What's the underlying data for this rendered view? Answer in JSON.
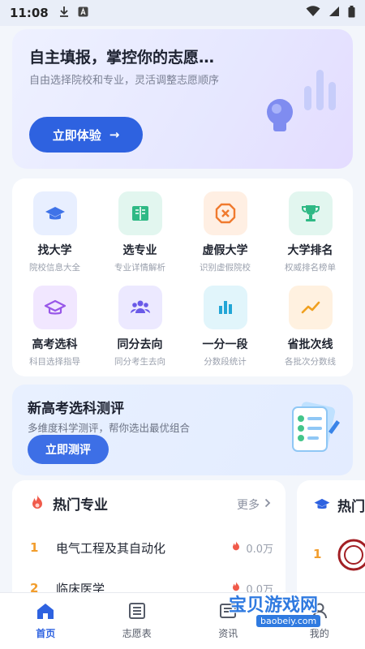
{
  "status_bar": {
    "time": "11:08",
    "download_icon": "download-icon",
    "a_icon": "a-badge-icon"
  },
  "hero": {
    "title": "自主填报，掌控你的志愿…",
    "subtitle": "自由选择院校和专业，灵活调整志愿顺序",
    "button_label": "立即体验",
    "button_arrow": "→"
  },
  "grid": [
    {
      "title": "找大学",
      "sub": "院校信息大全",
      "icon": "graduation-cap-icon",
      "bg": "#e8efff",
      "fg": "#3f73e8"
    },
    {
      "title": "选专业",
      "sub": "专业详情解析",
      "icon": "open-book-icon",
      "bg": "#e2f6ef",
      "fg": "#2fb985"
    },
    {
      "title": "虚假大学",
      "sub": "识别虚假院校",
      "icon": "warning-octagon-icon",
      "bg": "#ffefe3",
      "fg": "#f07a2e"
    },
    {
      "title": "大学排名",
      "sub": "权威排名榜单",
      "icon": "trophy-icon",
      "bg": "#e2f6ef",
      "fg": "#2fb985"
    },
    {
      "title": "高考选科",
      "sub": "科目选择指导",
      "icon": "mortarboard-icon",
      "bg": "#f1e7ff",
      "fg": "#9857e8"
    },
    {
      "title": "同分去向",
      "sub": "同分考生去向",
      "icon": "people-group-icon",
      "bg": "#ece9ff",
      "fg": "#6a5ae8"
    },
    {
      "title": "一分一段",
      "sub": "分数段统计",
      "icon": "bar-chart-icon",
      "bg": "#e1f5fb",
      "fg": "#22a6d6"
    },
    {
      "title": "省批次线",
      "sub": "各批次分数线",
      "icon": "trend-line-icon",
      "bg": "#fff1e0",
      "fg": "#f0a020"
    }
  ],
  "promo": {
    "title": "新高考选科测评",
    "subtitle": "多维度科学测评，帮你选出最优组合",
    "button_label": "立即测评"
  },
  "hot_majors": {
    "title": "热门专业",
    "more_label": "更多",
    "rows": [
      {
        "rank": "1",
        "name": "电气工程及其自动化",
        "count": "0.0万"
      },
      {
        "rank": "2",
        "name": "临床医学",
        "count": "0.0万"
      }
    ]
  },
  "hot_side": {
    "title": "热门",
    "rank": "1"
  },
  "tabbar": [
    {
      "label": "首页",
      "icon": "home-icon",
      "active": true
    },
    {
      "label": "志愿表",
      "icon": "list-icon",
      "active": false
    },
    {
      "label": "资讯",
      "icon": "news-icon",
      "active": false
    },
    {
      "label": "我的",
      "icon": "user-icon",
      "active": false
    }
  ],
  "watermark": {
    "text": "宝贝游戏网",
    "url": "baobeiy.com"
  },
  "colors": {
    "primary": "#2e62e0",
    "accent_orange": "#f29d2c",
    "background": "#f3f6fb"
  }
}
